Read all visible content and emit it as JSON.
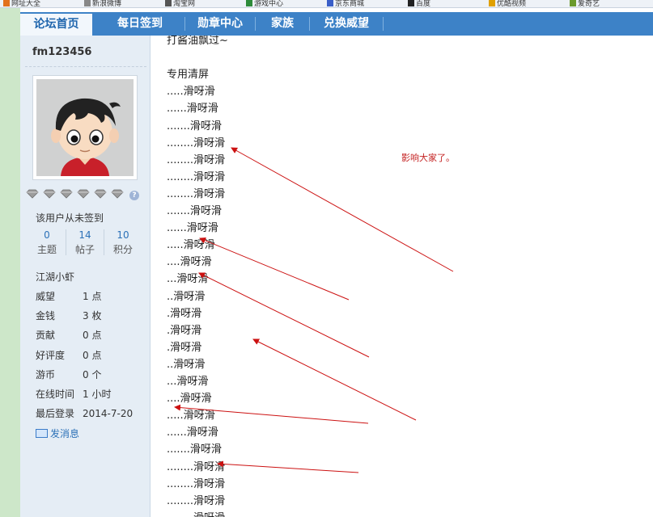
{
  "browser": {
    "bookmarks": [
      "网址大全",
      "新浪微博",
      "淘宝网",
      "游戏中心",
      "京东商城",
      "百度",
      "优酷视频",
      "爱奇艺"
    ]
  },
  "nav": {
    "tabs": [
      {
        "label": "论坛首页",
        "active": true
      },
      {
        "label": "每日签到",
        "active": false
      },
      {
        "label": "勋章中心",
        "active": false
      },
      {
        "label": "家族",
        "active": false
      },
      {
        "label": "兑换威望",
        "active": false
      }
    ]
  },
  "user": {
    "name": "fm123456",
    "sign_status": "该用户从未签到",
    "stats": [
      {
        "value": "0",
        "label": "主题"
      },
      {
        "value": "14",
        "label": "帖子"
      },
      {
        "value": "10",
        "label": "积分"
      }
    ],
    "rank": "江湖小虾",
    "info": [
      {
        "key": "威望",
        "value": "1 点"
      },
      {
        "key": "金钱",
        "value": "3 枚"
      },
      {
        "key": "贡献",
        "value": "0 点"
      },
      {
        "key": "好评度",
        "value": "0 点"
      },
      {
        "key": "游币",
        "value": "0 个"
      },
      {
        "key": "在线时间",
        "value": "1 小时"
      },
      {
        "key": "最后登录",
        "value": "2014-7-20"
      }
    ],
    "message_label": "发消息"
  },
  "post": {
    "lines": [
      "打酱油飘过~",
      "",
      "专用清屏",
      ".....滑呀滑",
      "......滑呀滑",
      ".......滑呀滑",
      "........滑呀滑",
      "........滑呀滑",
      "........滑呀滑",
      "........滑呀滑",
      ".......滑呀滑",
      "......滑呀滑",
      ".....滑呀滑",
      "....滑呀滑",
      "...滑呀滑",
      "..滑呀滑",
      ".滑呀滑",
      ".滑呀滑",
      ".滑呀滑",
      "..滑呀滑",
      "...滑呀滑",
      "....滑呀滑",
      ".....滑呀滑",
      "......滑呀滑",
      ".......滑呀滑",
      "........滑呀滑",
      "........滑呀滑",
      "........滑呀滑",
      "........滑呀滑"
    ],
    "annotation": "影响大家了。"
  },
  "colors": {
    "nav_bg": "#3d82c7",
    "sidebar_bg": "#e5edf5",
    "link": "#2d72b8",
    "arrow": "#cc1111"
  }
}
